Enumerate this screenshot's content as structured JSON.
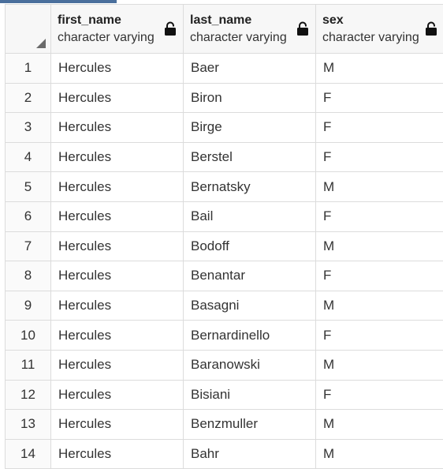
{
  "columns": [
    {
      "name": "first_name",
      "type": "character varying"
    },
    {
      "name": "last_name",
      "type": "character varying"
    },
    {
      "name": "sex",
      "type": "character varying"
    }
  ],
  "rows": [
    {
      "n": "1",
      "first_name": "Hercules",
      "last_name": "Baer",
      "sex": "M"
    },
    {
      "n": "2",
      "first_name": "Hercules",
      "last_name": "Biron",
      "sex": "F"
    },
    {
      "n": "3",
      "first_name": "Hercules",
      "last_name": "Birge",
      "sex": "F"
    },
    {
      "n": "4",
      "first_name": "Hercules",
      "last_name": "Berstel",
      "sex": "F"
    },
    {
      "n": "5",
      "first_name": "Hercules",
      "last_name": "Bernatsky",
      "sex": "M"
    },
    {
      "n": "6",
      "first_name": "Hercules",
      "last_name": "Bail",
      "sex": "F"
    },
    {
      "n": "7",
      "first_name": "Hercules",
      "last_name": "Bodoff",
      "sex": "M"
    },
    {
      "n": "8",
      "first_name": "Hercules",
      "last_name": "Benantar",
      "sex": "F"
    },
    {
      "n": "9",
      "first_name": "Hercules",
      "last_name": "Basagni",
      "sex": "M"
    },
    {
      "n": "10",
      "first_name": "Hercules",
      "last_name": "Bernardinello",
      "sex": "F"
    },
    {
      "n": "11",
      "first_name": "Hercules",
      "last_name": "Baranowski",
      "sex": "M"
    },
    {
      "n": "12",
      "first_name": "Hercules",
      "last_name": "Bisiani",
      "sex": "F"
    },
    {
      "n": "13",
      "first_name": "Hercules",
      "last_name": "Benzmuller",
      "sex": "M"
    },
    {
      "n": "14",
      "first_name": "Hercules",
      "last_name": "Bahr",
      "sex": "M"
    }
  ],
  "colors": {
    "accent": "#4a6f9c",
    "grid_line": "#dcdcdc",
    "header_bg": "#f7f7f7"
  }
}
